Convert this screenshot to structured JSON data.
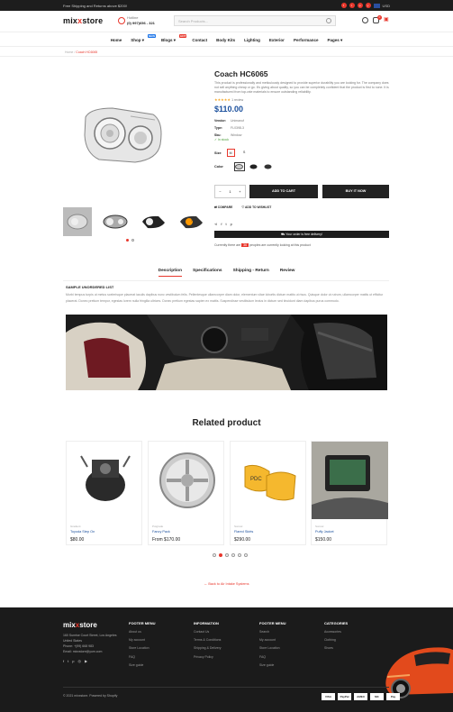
{
  "topbar": {
    "text": "Free Shipping and Returns above $200!",
    "currency": "USD"
  },
  "header": {
    "logo_main": "mix",
    "logo_x": "x",
    "logo_end": "store",
    "hotline_label": "Hotline",
    "hotline_number": "(0) 997)656 - 321",
    "search_placeholder": "Search Products...",
    "wishlist_count": "0",
    "cart_count": "0"
  },
  "nav": {
    "items": [
      "Home",
      "Shop",
      "Blogs",
      "Contact",
      "Body Kits",
      "Lighting",
      "Exterior",
      "Performance",
      "Pages"
    ],
    "shop_tag": "NEW",
    "blogs_tag": "HOT"
  },
  "breadcrumb": {
    "home": "Home",
    "sep": "/",
    "current": "Coach HC6065"
  },
  "product": {
    "title": "Coach HC6065",
    "description": "This product is professionally and meticulously designed to provide superior durability you are looking for. The company does not sell anything cheap or go. It's giving about quality, so you can be completely confident that the product is first to none. It is manufactured from top-rate materials to ensure outstanding reliability.",
    "stars": "★★★★★",
    "reviews": "1 review",
    "price": "$110.00",
    "vendor_label": "Vendor:",
    "vendor": "Unimanuf",
    "type_label": "Type:",
    "type": "FL0398-3",
    "sku_label": "Sku:",
    "sku": "Window",
    "stock": "In stock",
    "size_label": "Size",
    "sizes": [
      "M",
      "S"
    ],
    "color_label": "Color",
    "qty": "1",
    "add_to_cart": "ADD TO CART",
    "buy_now": "BUY IT NOW",
    "compare": "COMPARE",
    "wishlist": "ADD TO WISHLIST",
    "delivery": "Your order is free delivery!",
    "viewers_pre": "Currently there are",
    "viewers_count": "36",
    "viewers_post": "peoples are currently looking at this product"
  },
  "tabs": [
    "Description",
    "Specifications",
    "Shipping - Return",
    "Review"
  ],
  "description": {
    "heading": "SAMPLE UNORDERED LIST",
    "text": "Morbi tempus turpis ut metus scelerisque placerat iaculis dapibus nunc vestibulum felis. Pellentesque ullamcorper diam dolor, elementum vitae lobortis dictum mattis ut risus. Quisque dolor ut rutrum, ullamcorper mattis ut efficitur placerat. Donec pretium tempor, egestas lorem nulla fringilla ultrices. Donec pretium egestas sapien ex mattis. Suspendisse vestibulum lectus in dictum sed tincidunt diam dapibus purus commodo."
  },
  "related": {
    "heading": "Related product",
    "cards": [
      {
        "vendor": "Gradient",
        "name": "Toyoda Step On",
        "price": "$80.00"
      },
      {
        "vendor": "Potgrade",
        "name": "Fancy Pack",
        "price": "From $170.00"
      },
      {
        "vendor": "Sonnel",
        "name": "Flared Skirts",
        "price": "$290.00"
      },
      {
        "vendor": "Sonnel",
        "name": "Puffy Jacket",
        "price": "$150.00"
      }
    ],
    "back": "← Back to Air Intake Systems"
  },
  "footer": {
    "address": [
      "160 Sunrise Court Street, Los Angeles",
      "United States",
      "Phone: +(99) 668 983",
      "Email: mixxstore@yum.com"
    ],
    "col1_title": "FOOTER MENU",
    "col1": [
      "About us",
      "My account",
      "Store Location",
      "FAQ",
      "Size guide"
    ],
    "col2_title": "INFORMATION",
    "col2": [
      "Contact Us",
      "Terms & Conditions",
      "Shipping & Delivery",
      "Privacy Policy"
    ],
    "col3_title": "FOOTER MENU",
    "col3": [
      "Search",
      "My account",
      "Store Location",
      "FAQ",
      "Size guide"
    ],
    "col4_title": "CATEGORIES",
    "col4": [
      "Accessories",
      "Clothing",
      "Shoes"
    ],
    "copyright": "© 2021 mixxstore. Powered by Shopify",
    "payments": [
      "VISA",
      "PayPal",
      "AMEX",
      "MC",
      "Pay"
    ]
  },
  "colors": {
    "accent": "#e8372c",
    "price": "#1a4f9c",
    "dark": "#1d1d1d"
  }
}
